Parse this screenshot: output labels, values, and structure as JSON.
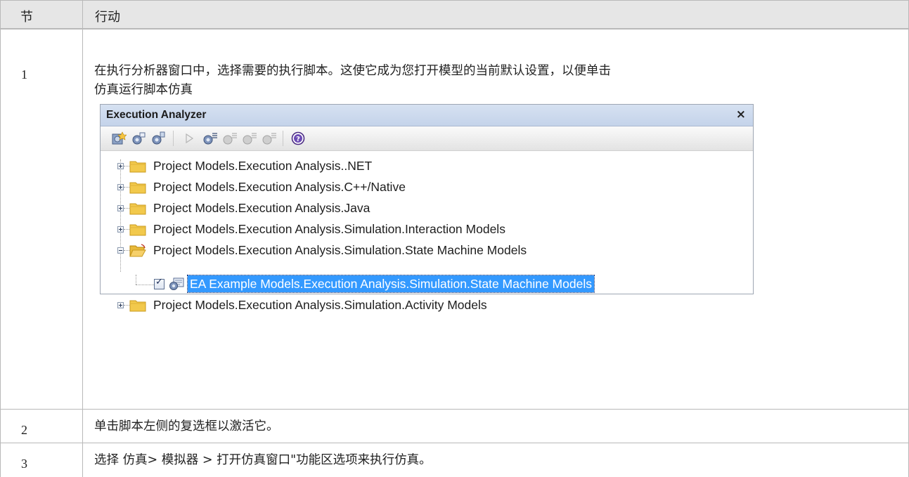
{
  "table": {
    "headers": [
      "节",
      "行动"
    ],
    "rows": [
      {
        "num": "1",
        "text": "在执行分析器窗口中，选择需要的执行脚本。这使它成为您打开模型的当前默认设置，以便单击仿真运行脚本仿真"
      },
      {
        "num": "2",
        "text": "单击脚本左侧的复选框以激活它。"
      },
      {
        "num": "3",
        "text": "选择 仿真> 模拟器 > 打开仿真窗口\"功能区选项来执行仿真。"
      }
    ],
    "row1_line1": "在执行分析器窗口中，选择需要的执行脚本。这使它成为您打开模型的当前默认设置，以便单击",
    "row1_line2": "仿真运行脚本仿真"
  },
  "panel": {
    "title": "Execution Analyzer",
    "close": "×",
    "toolbar_icons": [
      "new-script-icon",
      "edit-script-icon",
      "copy-script-icon",
      "run-icon",
      "debug-icon",
      "step-over-icon",
      "step-into-icon",
      "step-out-icon",
      "help-icon"
    ],
    "tree": [
      {
        "label": "Project Models.Execution Analysis..NET",
        "expanded": false
      },
      {
        "label": "Project Models.Execution Analysis.C++/Native",
        "expanded": false
      },
      {
        "label": "Project Models.Execution Analysis.Java",
        "expanded": false
      },
      {
        "label": "Project Models.Execution Analysis.Simulation.Interaction Models",
        "expanded": false
      },
      {
        "label": "Project Models.Execution Analysis.Simulation.State Machine Models",
        "expanded": true
      },
      {
        "label": "Project Models.Execution Analysis.Simulation.Activity Models",
        "expanded": false
      }
    ],
    "selected_child": {
      "label": "EA Example Models.Execution Analysis.Simulation.State Machine Models",
      "checked": true
    },
    "colors": {
      "selection": "#3399ff",
      "folder": "#f2c94c",
      "title_bg": "#c4d3ea"
    }
  }
}
